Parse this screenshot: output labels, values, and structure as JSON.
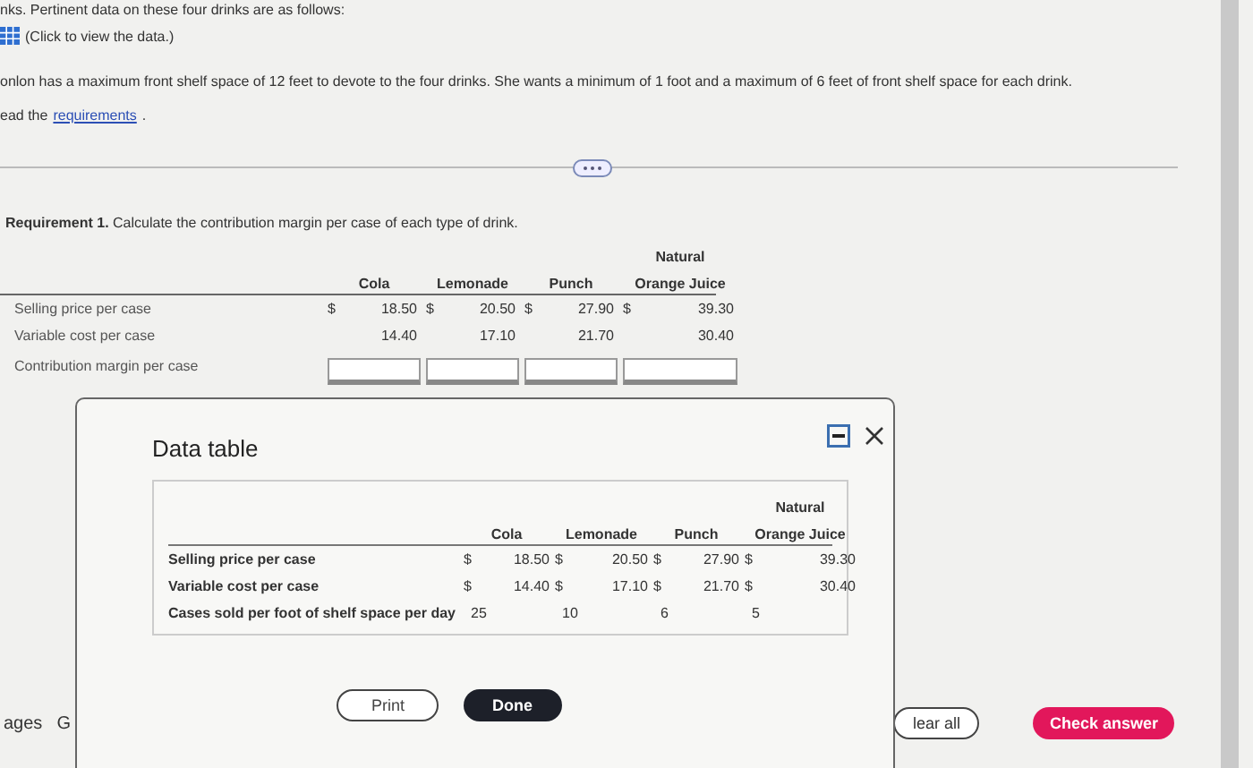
{
  "intro_text": "nks. Pertinent data on these four drinks are as follows:",
  "data_link": "(Click to view the data.)",
  "problem_text": "onlon has a maximum front shelf space of 12 feet to devote to the four drinks. She wants a minimum of 1 foot and a maximum of 6 feet of front shelf space for each drink.",
  "read_prefix": "ead the",
  "requirements_link": "requirements",
  "read_suffix": ".",
  "requirement_text": "**Requirement 1.** Calculate the contribution margin per case of each type of drink.",
  "cm_table": {
    "columns": [
      {
        "name": "Cola"
      },
      {
        "name": "Lemonade"
      },
      {
        "name": "Punch"
      },
      {
        "top": "Natural",
        "name": "Orange Juice"
      }
    ],
    "rows": [
      {
        "label": "Selling price per case",
        "cells": [
          {
            "currency": "$",
            "value": "18.50"
          },
          {
            "currency": "$",
            "value": "20.50"
          },
          {
            "currency": "$",
            "value": "27.90"
          },
          {
            "currency": "$",
            "value": "39.30"
          }
        ]
      },
      {
        "label": "Variable cost per case",
        "cells": [
          {
            "value": "14.40"
          },
          {
            "value": "17.10"
          },
          {
            "value": "21.70"
          },
          {
            "value": "30.40"
          }
        ]
      }
    ],
    "answer_row": {
      "label": "Contribution margin per case"
    }
  },
  "modal": {
    "title": "Data table",
    "table": {
      "columns": [
        {
          "name": "Cola"
        },
        {
          "name": "Lemonade"
        },
        {
          "name": "Punch"
        },
        {
          "top": "Natural",
          "name": "Orange Juice"
        }
      ],
      "rows": [
        {
          "label": "Selling price per case",
          "cells": [
            {
              "currency": "$",
              "value": "18.50"
            },
            {
              "currency": "$",
              "value": "20.50"
            },
            {
              "currency": "$",
              "value": "27.90"
            },
            {
              "currency": "$",
              "value": "39.30"
            }
          ]
        },
        {
          "label": "Variable cost per case",
          "cells": [
            {
              "currency": "$",
              "value": "14.40"
            },
            {
              "currency": "$",
              "value": "17.10"
            },
            {
              "currency": "$",
              "value": "21.70"
            },
            {
              "currency": "$",
              "value": "30.40"
            }
          ]
        },
        {
          "label": "Cases sold per foot of shelf space per day",
          "cells": [
            {
              "value": "25"
            },
            {
              "value": "10"
            },
            {
              "value": "6"
            },
            {
              "value": "5"
            }
          ]
        }
      ]
    },
    "buttons": [
      "Print",
      "Done"
    ]
  },
  "footer": {
    "left": [
      "ages",
      "G"
    ],
    "clear": "lear all",
    "check": "Check answer"
  }
}
